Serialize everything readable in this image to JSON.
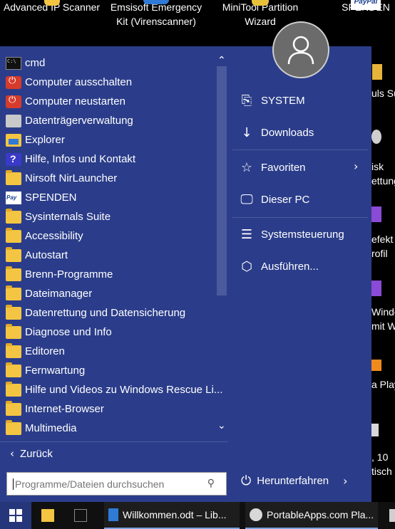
{
  "desktop": {
    "top_icons": [
      {
        "label": "Advanced IP Scanner",
        "line2": "",
        "color": "#f4c542"
      },
      {
        "label": "Emsisoft Emergency",
        "line2": "Kit (Virenscanner)",
        "color": "#2f7ad6"
      },
      {
        "label": "MiniTool Partition",
        "line2": "Wizard",
        "color": "#e7c13b"
      },
      {
        "label": "SPENDEN",
        "line2": "",
        "color": "#ffffff"
      }
    ],
    "paypal_text": "PayPal",
    "right_texts": [
      "uls Su",
      "isk",
      "ettung",
      "efekt",
      "rofil",
      "Windo",
      "mit W",
      "a Play",
      ", 10",
      "tisch"
    ]
  },
  "start_menu": {
    "scroll_up": "⌃",
    "scroll_down": "⌄",
    "items": [
      {
        "label": "cmd",
        "icon": "cmd-icon"
      },
      {
        "label": "Computer ausschalten",
        "icon": "power-icon"
      },
      {
        "label": "Computer neustarten",
        "icon": "power-icon"
      },
      {
        "label": "Datenträgerverwaltung",
        "icon": "disk-management-icon"
      },
      {
        "label": "Explorer",
        "icon": "explorer-icon"
      },
      {
        "label": "Hilfe, Infos und Kontakt",
        "icon": "help-icon"
      },
      {
        "label": "Nirsoft NirLauncher",
        "icon": "folder-icon"
      },
      {
        "label": "SPENDEN",
        "icon": "paypal-icon"
      },
      {
        "label": "Sysinternals Suite",
        "icon": "folder-icon"
      },
      {
        "label": "Accessibility",
        "icon": "folder-icon"
      },
      {
        "label": "Autostart",
        "icon": "folder-icon"
      },
      {
        "label": "Brenn-Programme",
        "icon": "folder-icon"
      },
      {
        "label": "Dateimanager",
        "icon": "folder-icon"
      },
      {
        "label": "Datenrettung und Datensicherung",
        "icon": "folder-icon"
      },
      {
        "label": "Diagnose und Info",
        "icon": "folder-icon"
      },
      {
        "label": "Editoren",
        "icon": "folder-icon"
      },
      {
        "label": "Fernwartung",
        "icon": "folder-icon"
      },
      {
        "label": "Hilfe und Videos zu Windows Rescue Li...",
        "icon": "folder-icon"
      },
      {
        "label": "Internet-Browser",
        "icon": "folder-icon"
      },
      {
        "label": "Multimedia",
        "icon": "folder-icon"
      }
    ],
    "back_label": "Zurück",
    "search_placeholder": "Programme/Dateien durchsuchen",
    "right_items": [
      {
        "label": "SYSTEM",
        "icon": "user-folder-icon",
        "glyph": "⎘"
      },
      {
        "label": "Downloads",
        "icon": "download-icon",
        "glyph": "↓"
      },
      {
        "label": "Favoriten",
        "icon": "star-icon",
        "glyph": "☆"
      },
      {
        "label": "Dieser PC",
        "icon": "monitor-icon",
        "glyph": "🖵"
      },
      {
        "label": "Systemsteuerung",
        "icon": "control-panel-icon",
        "glyph": "☰"
      },
      {
        "label": "Ausführen...",
        "icon": "run-icon",
        "glyph": "⬡"
      }
    ],
    "shutdown_label": "Herunterfahren"
  },
  "taskbar": {
    "buttons": [
      {
        "label": "",
        "icon": "file-explorer-icon"
      },
      {
        "label": "",
        "icon": "cmd-icon"
      },
      {
        "label": "Willkommen.odt – Lib...",
        "icon": "writer-icon"
      },
      {
        "label": "PortableApps.com Pla...",
        "icon": "portableapps-icon"
      }
    ]
  }
}
